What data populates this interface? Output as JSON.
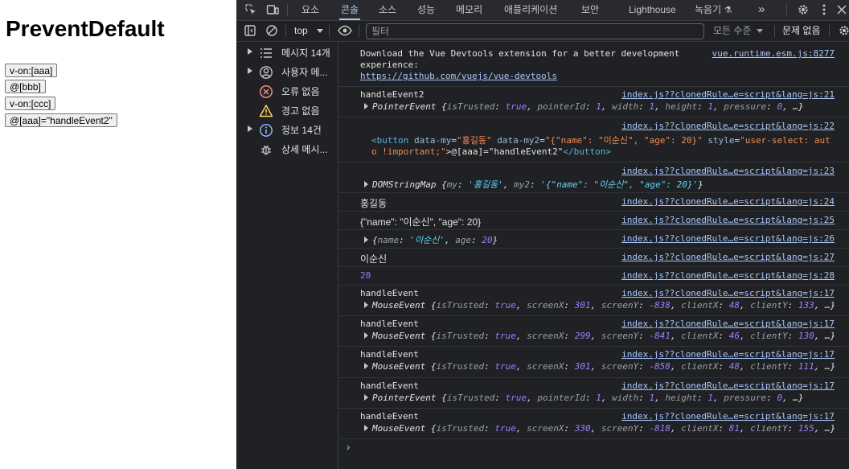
{
  "page": {
    "title": "PreventDefault",
    "buttons": [
      "v-on:[aaa]",
      "@[bbb]",
      "v-on:[ccc]",
      "@[aaa]=\"handleEvent2\""
    ]
  },
  "devtools": {
    "tabs": [
      "요소",
      "콘솔",
      "소스",
      "성능",
      "메모리",
      "애플리케이션",
      "보안",
      "Lighthouse",
      "녹음기"
    ],
    "active_tab": "콘솔",
    "more_tabs": "»",
    "context": "top",
    "filter_placeholder": "필터",
    "level": "모든 수준",
    "issues": "문제 없음",
    "colors": {
      "bg": "#202124",
      "link": "#a8c7fa",
      "active_tab": "#a8c7fa",
      "error": "#f28b82",
      "warning": "#fdd663",
      "info": "#8ab4f8"
    }
  },
  "sidebar": [
    {
      "label": "메시지 14개",
      "icon": "list-icon",
      "expandable": true
    },
    {
      "label": "사용자 메...",
      "icon": "user-icon",
      "expandable": true
    },
    {
      "label": "오류 없음",
      "icon": "error-icon",
      "expandable": false
    },
    {
      "label": "경고 없음",
      "icon": "warning-icon",
      "expandable": false
    },
    {
      "label": "정보 14건",
      "icon": "info-icon",
      "expandable": true
    },
    {
      "label": "상세 메시...",
      "icon": "bug-icon",
      "expandable": false
    }
  ],
  "console": {
    "vue_notice": {
      "text1": "Download the Vue Devtools extension for a better development",
      "text2": "experience:",
      "link": "https://github.com/vuejs/vue-devtools",
      "source": "vue.runtime.esm.js:8277"
    },
    "messages": [
      {
        "text": "handleEvent2",
        "source": "index.js??clonedRule…e=script&lang=js:21",
        "obj_name": "PointerEvent",
        "obj_body": [
          [
            "isTrusted",
            "true",
            "kw"
          ],
          [
            "pointerId",
            "1",
            "num"
          ],
          [
            "width",
            "1",
            "num"
          ],
          [
            "height",
            "1",
            "num"
          ],
          [
            "pressure",
            "0",
            "num"
          ]
        ]
      },
      {
        "source": "index.js??clonedRule…e=script&lang=js:22",
        "html_line1_a": "<button ",
        "html_attr1": "data-my",
        "html_val1": "\"홍길동\"",
        "html_attr2": " data-my2",
        "html_val2": "\"{\"name\": \"이순신\", \"age\": 20}\"",
        "html_attr3": " style",
        "html_val3": "\"user-select: aut",
        "html_line2_a": "o !important;\"",
        "html_line2_b": ">@[aaa]=\"handleEvent2\"",
        "html_line2_c": "</button>"
      },
      {
        "source": "index.js??clonedRule…e=script&lang=js:23",
        "obj_name": "DOMStringMap",
        "obj_my_key": "my",
        "obj_my_val": "'홍길동'",
        "obj_my2_key": "my2",
        "obj_my2_val": "'{\"name\": \"이순신\", \"age\": 20}'"
      },
      {
        "text": "홍길동",
        "source": "index.js??clonedRule…e=script&lang=js:24"
      },
      {
        "text": "{\"name\": \"이순신\", \"age\": 20}",
        "source": "index.js??clonedRule…e=script&lang=js:25"
      },
      {
        "source": "index.js??clonedRule…e=script&lang=js:26",
        "obj_name_key": "name",
        "obj_name_val": "'이순신'",
        "obj_age_key": "age",
        "obj_age_val": "20"
      },
      {
        "text": "이순신",
        "source": "index.js??clonedRule…e=script&lang=js:27"
      },
      {
        "text": "20",
        "source": "index.js??clonedRule…e=script&lang=js:28"
      },
      {
        "text": "handleEvent",
        "source": "index.js??clonedRule…e=script&lang=js:17",
        "obj_name": "MouseEvent",
        "obj_body": [
          [
            "isTrusted",
            "true",
            "kw"
          ],
          [
            "screenX",
            "301",
            "num"
          ],
          [
            "screenY",
            "-838",
            "num"
          ],
          [
            "clientX",
            "48",
            "num"
          ],
          [
            "clientY",
            "133",
            "num"
          ]
        ]
      },
      {
        "text": "handleEvent",
        "source": "index.js??clonedRule…e=script&lang=js:17",
        "obj_name": "MouseEvent",
        "obj_body": [
          [
            "isTrusted",
            "true",
            "kw"
          ],
          [
            "screenX",
            "299",
            "num"
          ],
          [
            "screenY",
            "-841",
            "num"
          ],
          [
            "clientX",
            "46",
            "num"
          ],
          [
            "clientY",
            "130",
            "num"
          ]
        ]
      },
      {
        "text": "handleEvent",
        "source": "index.js??clonedRule…e=script&lang=js:17",
        "obj_name": "MouseEvent",
        "obj_body": [
          [
            "isTrusted",
            "true",
            "kw"
          ],
          [
            "screenX",
            "301",
            "num"
          ],
          [
            "screenY",
            "-858",
            "num"
          ],
          [
            "clientX",
            "48",
            "num"
          ],
          [
            "clientY",
            "111",
            "num"
          ]
        ]
      },
      {
        "text": "handleEvent",
        "source": "index.js??clonedRule…e=script&lang=js:17",
        "obj_name": "PointerEvent",
        "obj_body": [
          [
            "isTrusted",
            "true",
            "kw"
          ],
          [
            "pointerId",
            "1",
            "num"
          ],
          [
            "width",
            "1",
            "num"
          ],
          [
            "height",
            "1",
            "num"
          ],
          [
            "pressure",
            "0",
            "num"
          ]
        ]
      },
      {
        "text": "handleEvent",
        "source": "index.js??clonedRule…e=script&lang=js:17",
        "obj_name": "MouseEvent",
        "obj_body": [
          [
            "isTrusted",
            "true",
            "kw"
          ],
          [
            "screenX",
            "330",
            "num"
          ],
          [
            "screenY",
            "-818",
            "num"
          ],
          [
            "clientX",
            "81",
            "num"
          ],
          [
            "clientY",
            "155",
            "num"
          ]
        ]
      }
    ],
    "prompt": "›"
  }
}
